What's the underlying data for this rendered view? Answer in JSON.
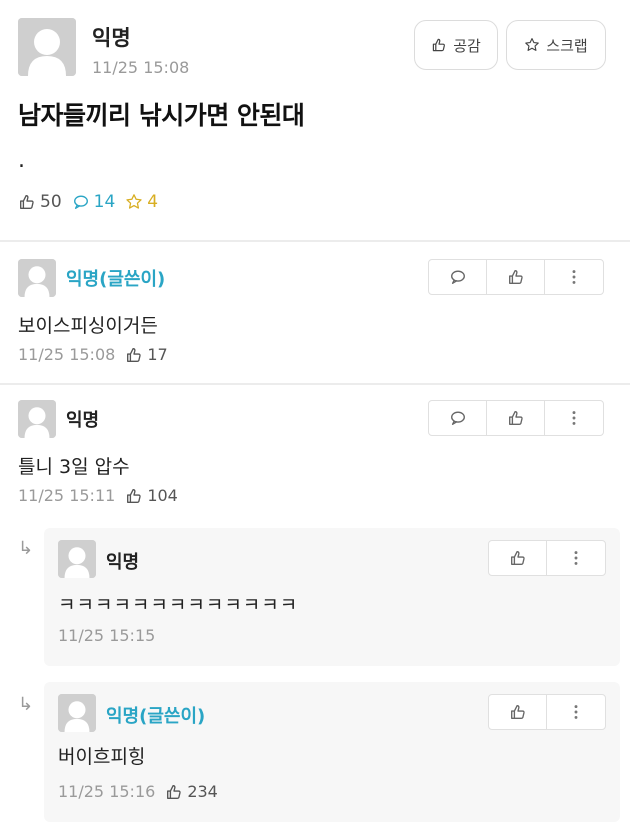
{
  "post": {
    "author": "익명",
    "time": "11/25 15:08",
    "like_button": "공감",
    "scrap_button": "스크랩",
    "title": "남자들끼리 낚시가면 안된대",
    "body": ".",
    "stats": {
      "likes": "50",
      "comments": "14",
      "scraps": "4"
    }
  },
  "comments": [
    {
      "author": "익명(글쓴이)",
      "text": "보이스피싱이거든",
      "time": "11/25 15:08",
      "likes": "17"
    },
    {
      "author": "익명",
      "text": "틀니 3일 압수",
      "time": "11/25 15:11",
      "likes": "104"
    }
  ],
  "replies": [
    {
      "author": "익명",
      "text": "ㅋㅋㅋㅋㅋㅋㅋㅋㅋㅋㅋㅋㅋ",
      "time": "11/25 15:15"
    },
    {
      "author": "익명(글쓴이)",
      "text": "버이흐피힝",
      "time": "11/25 15:16",
      "likes": "234"
    }
  ],
  "reply_arrow": "↳",
  "colors": {
    "op_accent": "#2aa5c5",
    "comment_stat": "#2aa5c5",
    "scrap_stat": "#d8ae22"
  },
  "icons": [
    "avatar-silhouette",
    "thumbs-up-icon",
    "star-icon",
    "speech-bubble-icon",
    "more-vertical-icon"
  ]
}
